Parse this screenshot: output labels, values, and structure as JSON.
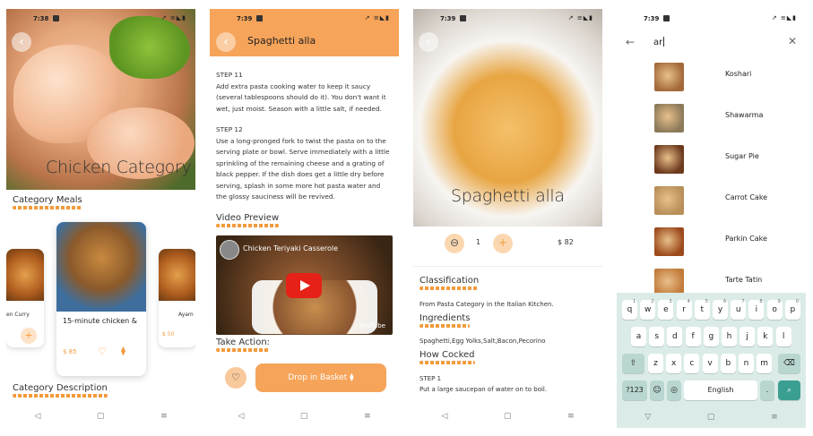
{
  "colors": {
    "accent": "#f39b3c",
    "topbar": "#f6a45a",
    "keyboard_bg": "#dbece8",
    "search_key": "#3a9f91"
  },
  "screen1": {
    "status_time": "7:38",
    "status_icons": "↗ ≡◣▮",
    "hero_title": "Chicken Category",
    "section_meals": "Category Meals",
    "card_main": {
      "name": "15-minute chicken &",
      "price": "$ 85",
      "heart_icon": "♡",
      "basket_icon": "⧫"
    },
    "card_left": {
      "name": "en Curry"
    },
    "card_right": {
      "name": "Ayam",
      "price": "$ 50"
    },
    "section_description": "Category Description"
  },
  "screen2": {
    "status_time": "7:39",
    "status_icons": "↗ ≡◣▮",
    "title": "Spaghetti alla",
    "step11_title": "STEP 11",
    "step11_text": "Add extra pasta cooking water to keep it saucy (several tablespoons should do it). You don't want it wet, just moist. Season with a little salt, if needed.",
    "step12_title": "STEP 12",
    "step12_text": "Use a long-pronged fork to twist the pasta on to the serving plate or bowl. Serve immediately with a little sprinkling of the remaining cheese and a grating of black pepper. If the dish does get a little dry before serving, splash in some more hot pasta water and the glossy sauciness will be revived.",
    "video_heading": "Video Preview",
    "video_title": "Chicken Teriyaki Casserole",
    "video_brand": "YouTube",
    "action_heading": "Take Action:",
    "drop_button": "Drop in Basket ⧫",
    "heart_icon": "♡"
  },
  "screen3": {
    "status_time": "7:39",
    "status_icons": "↗ ≡◣▮",
    "hero_title": "Spaghetti alla",
    "minus": "⊖",
    "plus": "+",
    "quantity": "1",
    "price": "$ 82",
    "classification_heading": "Classification",
    "classification_text": "From Pasta Category in the Italian Kitchen.",
    "ingredients_heading": "Ingredients",
    "ingredients_text": "Spaghetti,Egg Yolks,Salt,Bacon,Pecorino",
    "how_heading": "How Cocked",
    "step1_title": "STEP 1",
    "step1_text": "Put a large saucepan of water on to boil."
  },
  "screen4": {
    "status_time": "7:39",
    "status_icons": "↗ ≡◣▮",
    "search_value": "ar",
    "results": [
      {
        "name": "Koshari",
        "color": "#a46a3a"
      },
      {
        "name": "Shawarma",
        "color": "#8c7a5a"
      },
      {
        "name": "Sugar Pie",
        "color": "#6e3a1e"
      },
      {
        "name": "Carrot Cake",
        "color": "#b88f58"
      },
      {
        "name": "Parkin Cake",
        "color": "#9c4a1c"
      },
      {
        "name": "Tarte Tatin",
        "color": "#c27a3a"
      }
    ],
    "keys_row1": [
      "q",
      "w",
      "e",
      "r",
      "t",
      "y",
      "u",
      "i",
      "o",
      "p"
    ],
    "keys_row1_hints": [
      "1",
      "2",
      "3",
      "4",
      "5",
      "6",
      "7",
      "8",
      "9",
      "0"
    ],
    "keys_row2": [
      "a",
      "s",
      "d",
      "f",
      "g",
      "h",
      "j",
      "k",
      "l"
    ],
    "keys_row3": [
      "z",
      "x",
      "c",
      "v",
      "b",
      "n",
      "m"
    ],
    "key_shift": "⇧",
    "key_backspace": "⌫",
    "key_symbols": "?123",
    "key_emoji": "☺",
    "key_globe": "◎",
    "key_space": "English",
    "key_period": ".",
    "key_search": "⌕"
  },
  "nav": {
    "back": "◁",
    "home": "▢",
    "recent": "≡"
  }
}
